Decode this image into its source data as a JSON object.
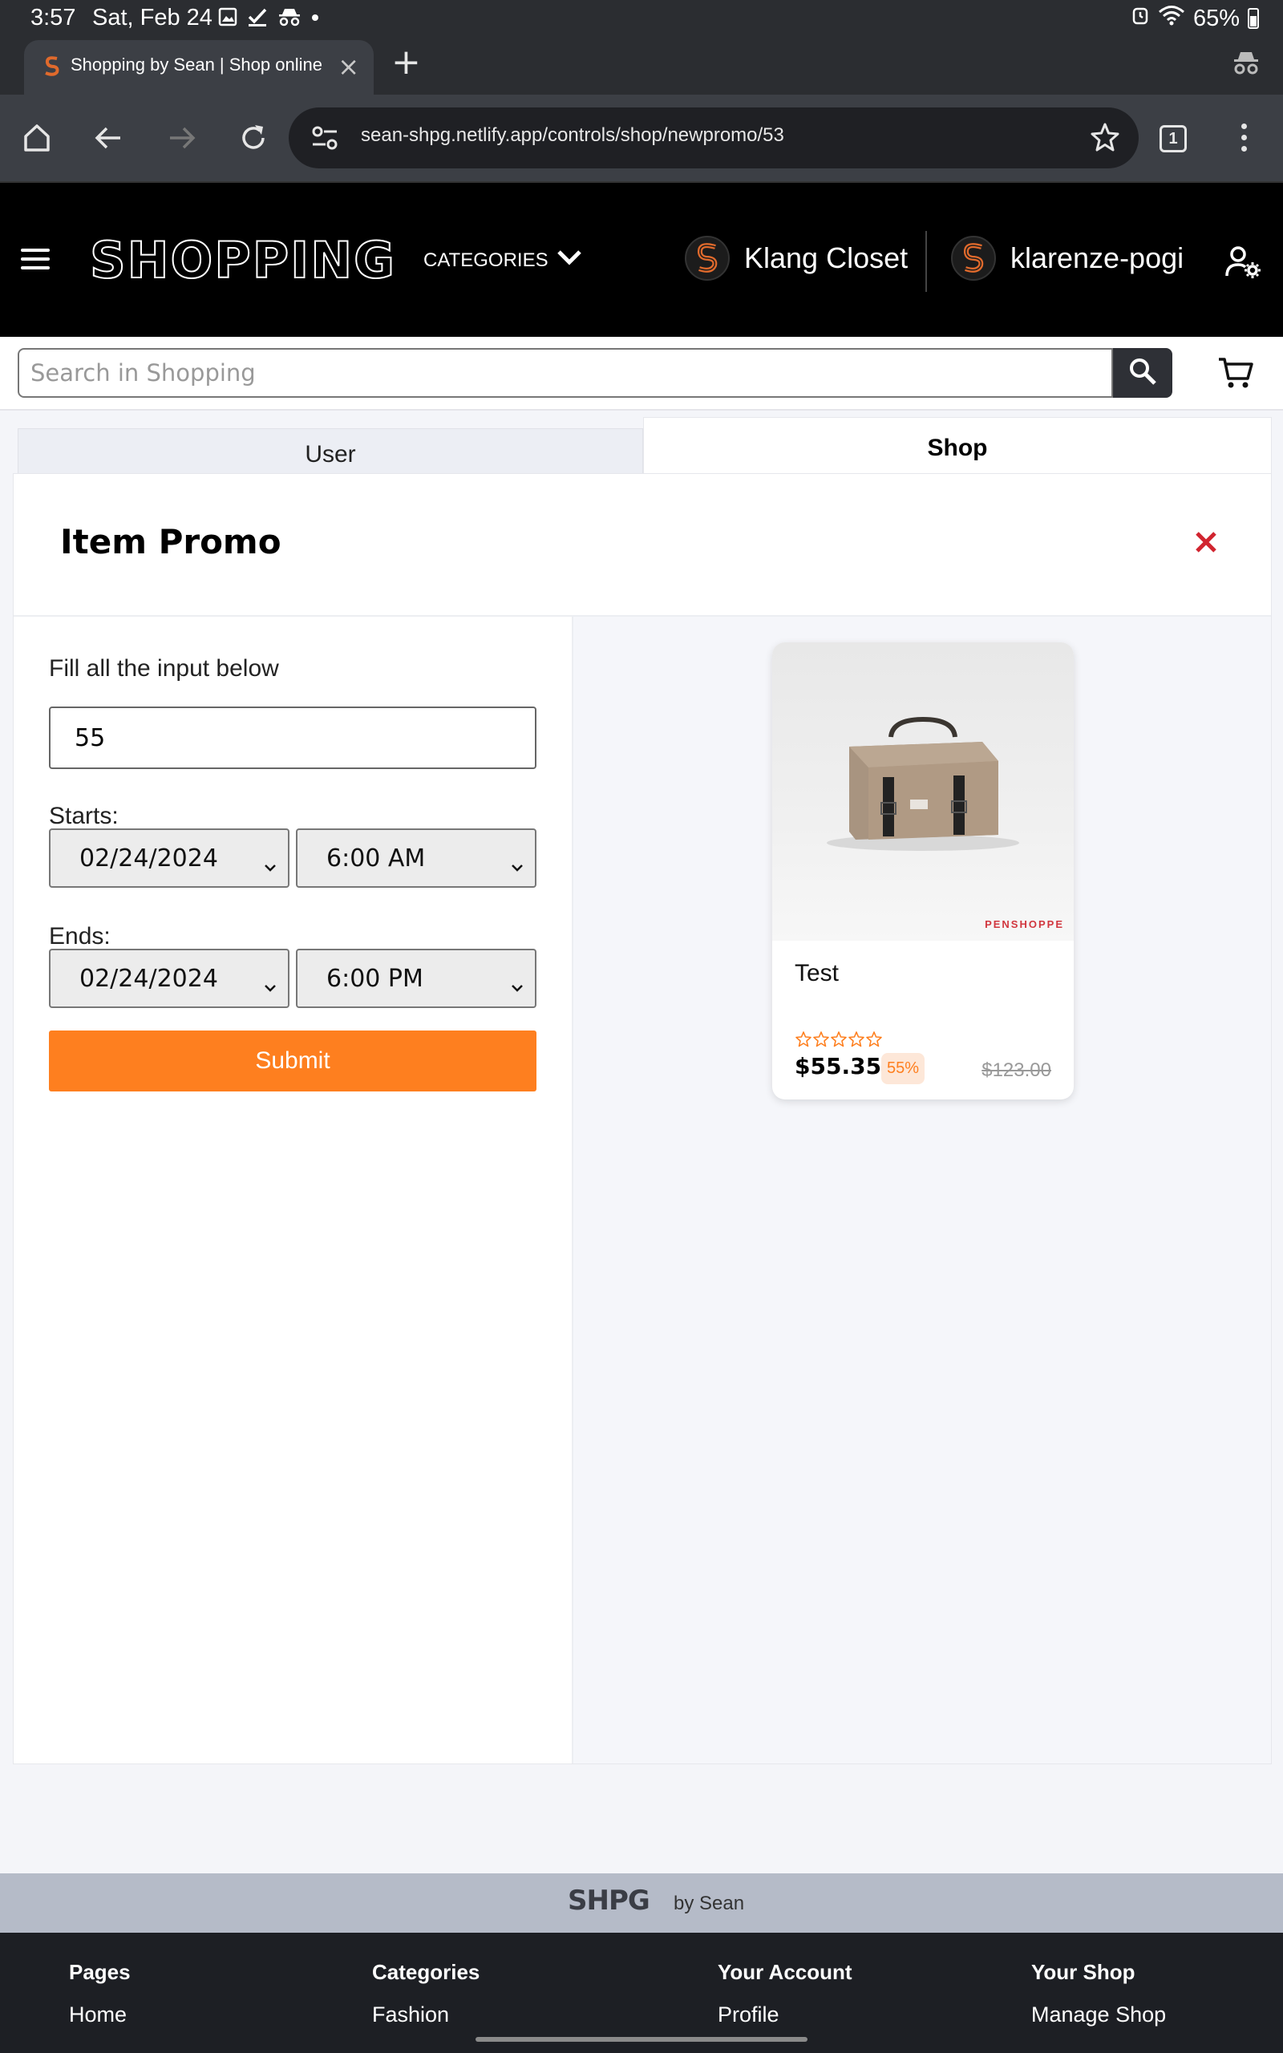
{
  "status_bar": {
    "time": "3:57",
    "date": "Sat, Feb 24",
    "battery": "65%"
  },
  "browser": {
    "tab_title": "Shopping by Sean | Shop online",
    "url": "sean-shpg.netlify.app/controls/shop/newpromo/53",
    "tab_count": "1"
  },
  "header": {
    "logo": "SHOPPING",
    "categories_label": "CATEGORIES",
    "shop_name": "Klang Closet",
    "username": "klarenze-pogi"
  },
  "search": {
    "placeholder": "Search in Shopping"
  },
  "tabs": {
    "user": "User",
    "shop": "Shop"
  },
  "promo": {
    "title": "Item Promo",
    "instruction": "Fill all the input below",
    "discount_value": "55",
    "starts_label": "Starts:",
    "start_date": "02/24/2024",
    "start_time": "6:00 AM",
    "ends_label": "Ends:",
    "end_date": "02/24/2024",
    "end_time": "6:00 PM",
    "submit_label": "Submit"
  },
  "product": {
    "name": "Test",
    "brand_mark": "PENSHOPPE",
    "rating": 0,
    "price": "$55.35",
    "discount_badge": "55%",
    "original_price": "$123.00"
  },
  "footer": {
    "logo": "SHPG",
    "by": "by Sean",
    "columns": [
      {
        "heading": "Pages",
        "link": "Home"
      },
      {
        "heading": "Categories",
        "link": "Fashion"
      },
      {
        "heading": "Your Account",
        "link": "Profile"
      },
      {
        "heading": "Your Shop",
        "link": "Manage Shop"
      }
    ]
  },
  "colors": {
    "accent": "#fe7f1f",
    "close_red": "#d1242f",
    "header_bg": "#000000",
    "browser_bg": "#3c3f45"
  }
}
